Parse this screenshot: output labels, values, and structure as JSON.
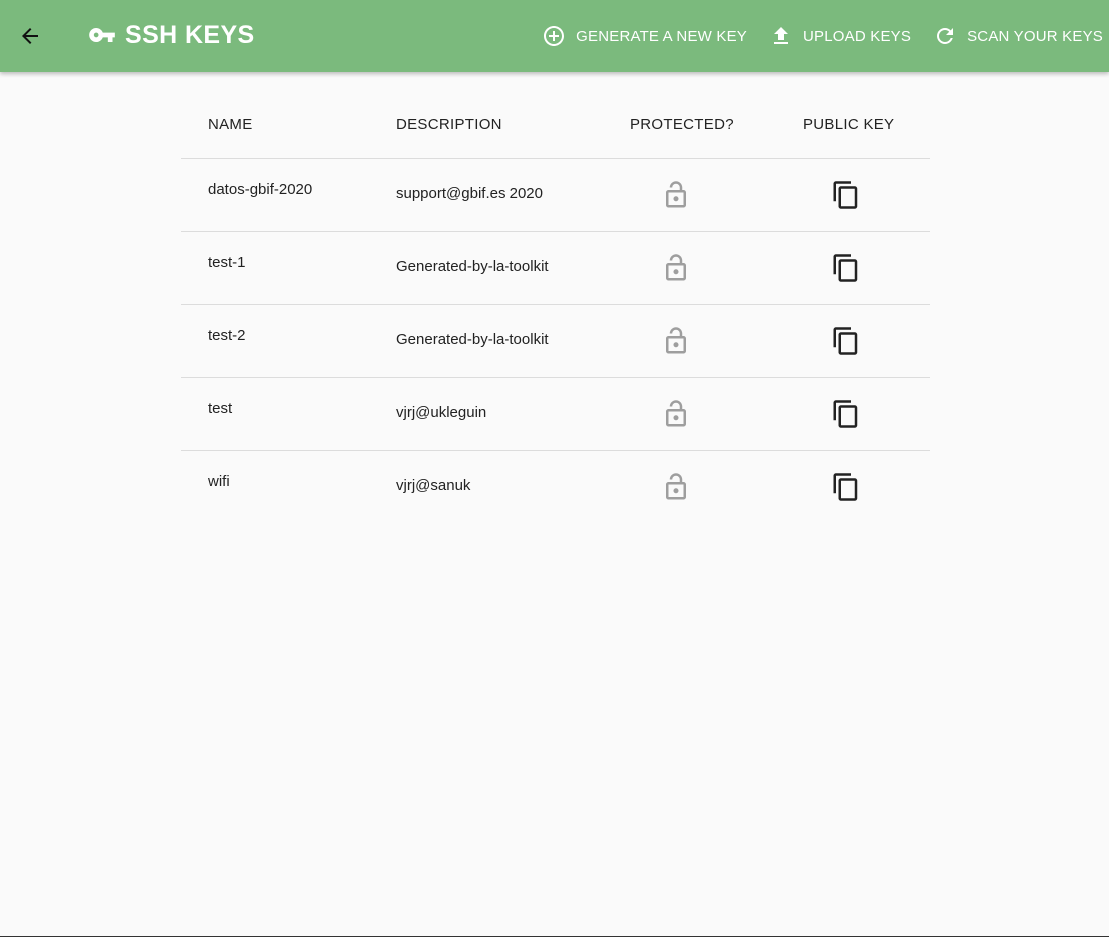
{
  "header": {
    "title": "SSH KEYS",
    "actions": [
      {
        "label": "GENERATE A NEW KEY",
        "icon": "plus-circle-icon"
      },
      {
        "label": "UPLOAD KEYS",
        "icon": "upload-icon"
      },
      {
        "label": "SCAN YOUR KEYS",
        "icon": "refresh-icon"
      }
    ]
  },
  "table": {
    "headers": {
      "name": "NAME",
      "description": "DESCRIPTION",
      "protected": "PROTECTED?",
      "public_key": "PUBLIC KEY"
    },
    "rows": [
      {
        "name": "datos-gbif-2020",
        "description": "support@gbif.es 2020"
      },
      {
        "name": "test-1",
        "description": "Generated-by-la-toolkit"
      },
      {
        "name": "test-2",
        "description": "Generated-by-la-toolkit"
      },
      {
        "name": "test",
        "description": "vjrj@ukleguin"
      },
      {
        "name": "wifi",
        "description": "vjrj@sanuk"
      }
    ]
  },
  "colors": {
    "appbar": "#7bba7d",
    "background": "#fafafa",
    "lock_icon": "#9e9e9e"
  }
}
